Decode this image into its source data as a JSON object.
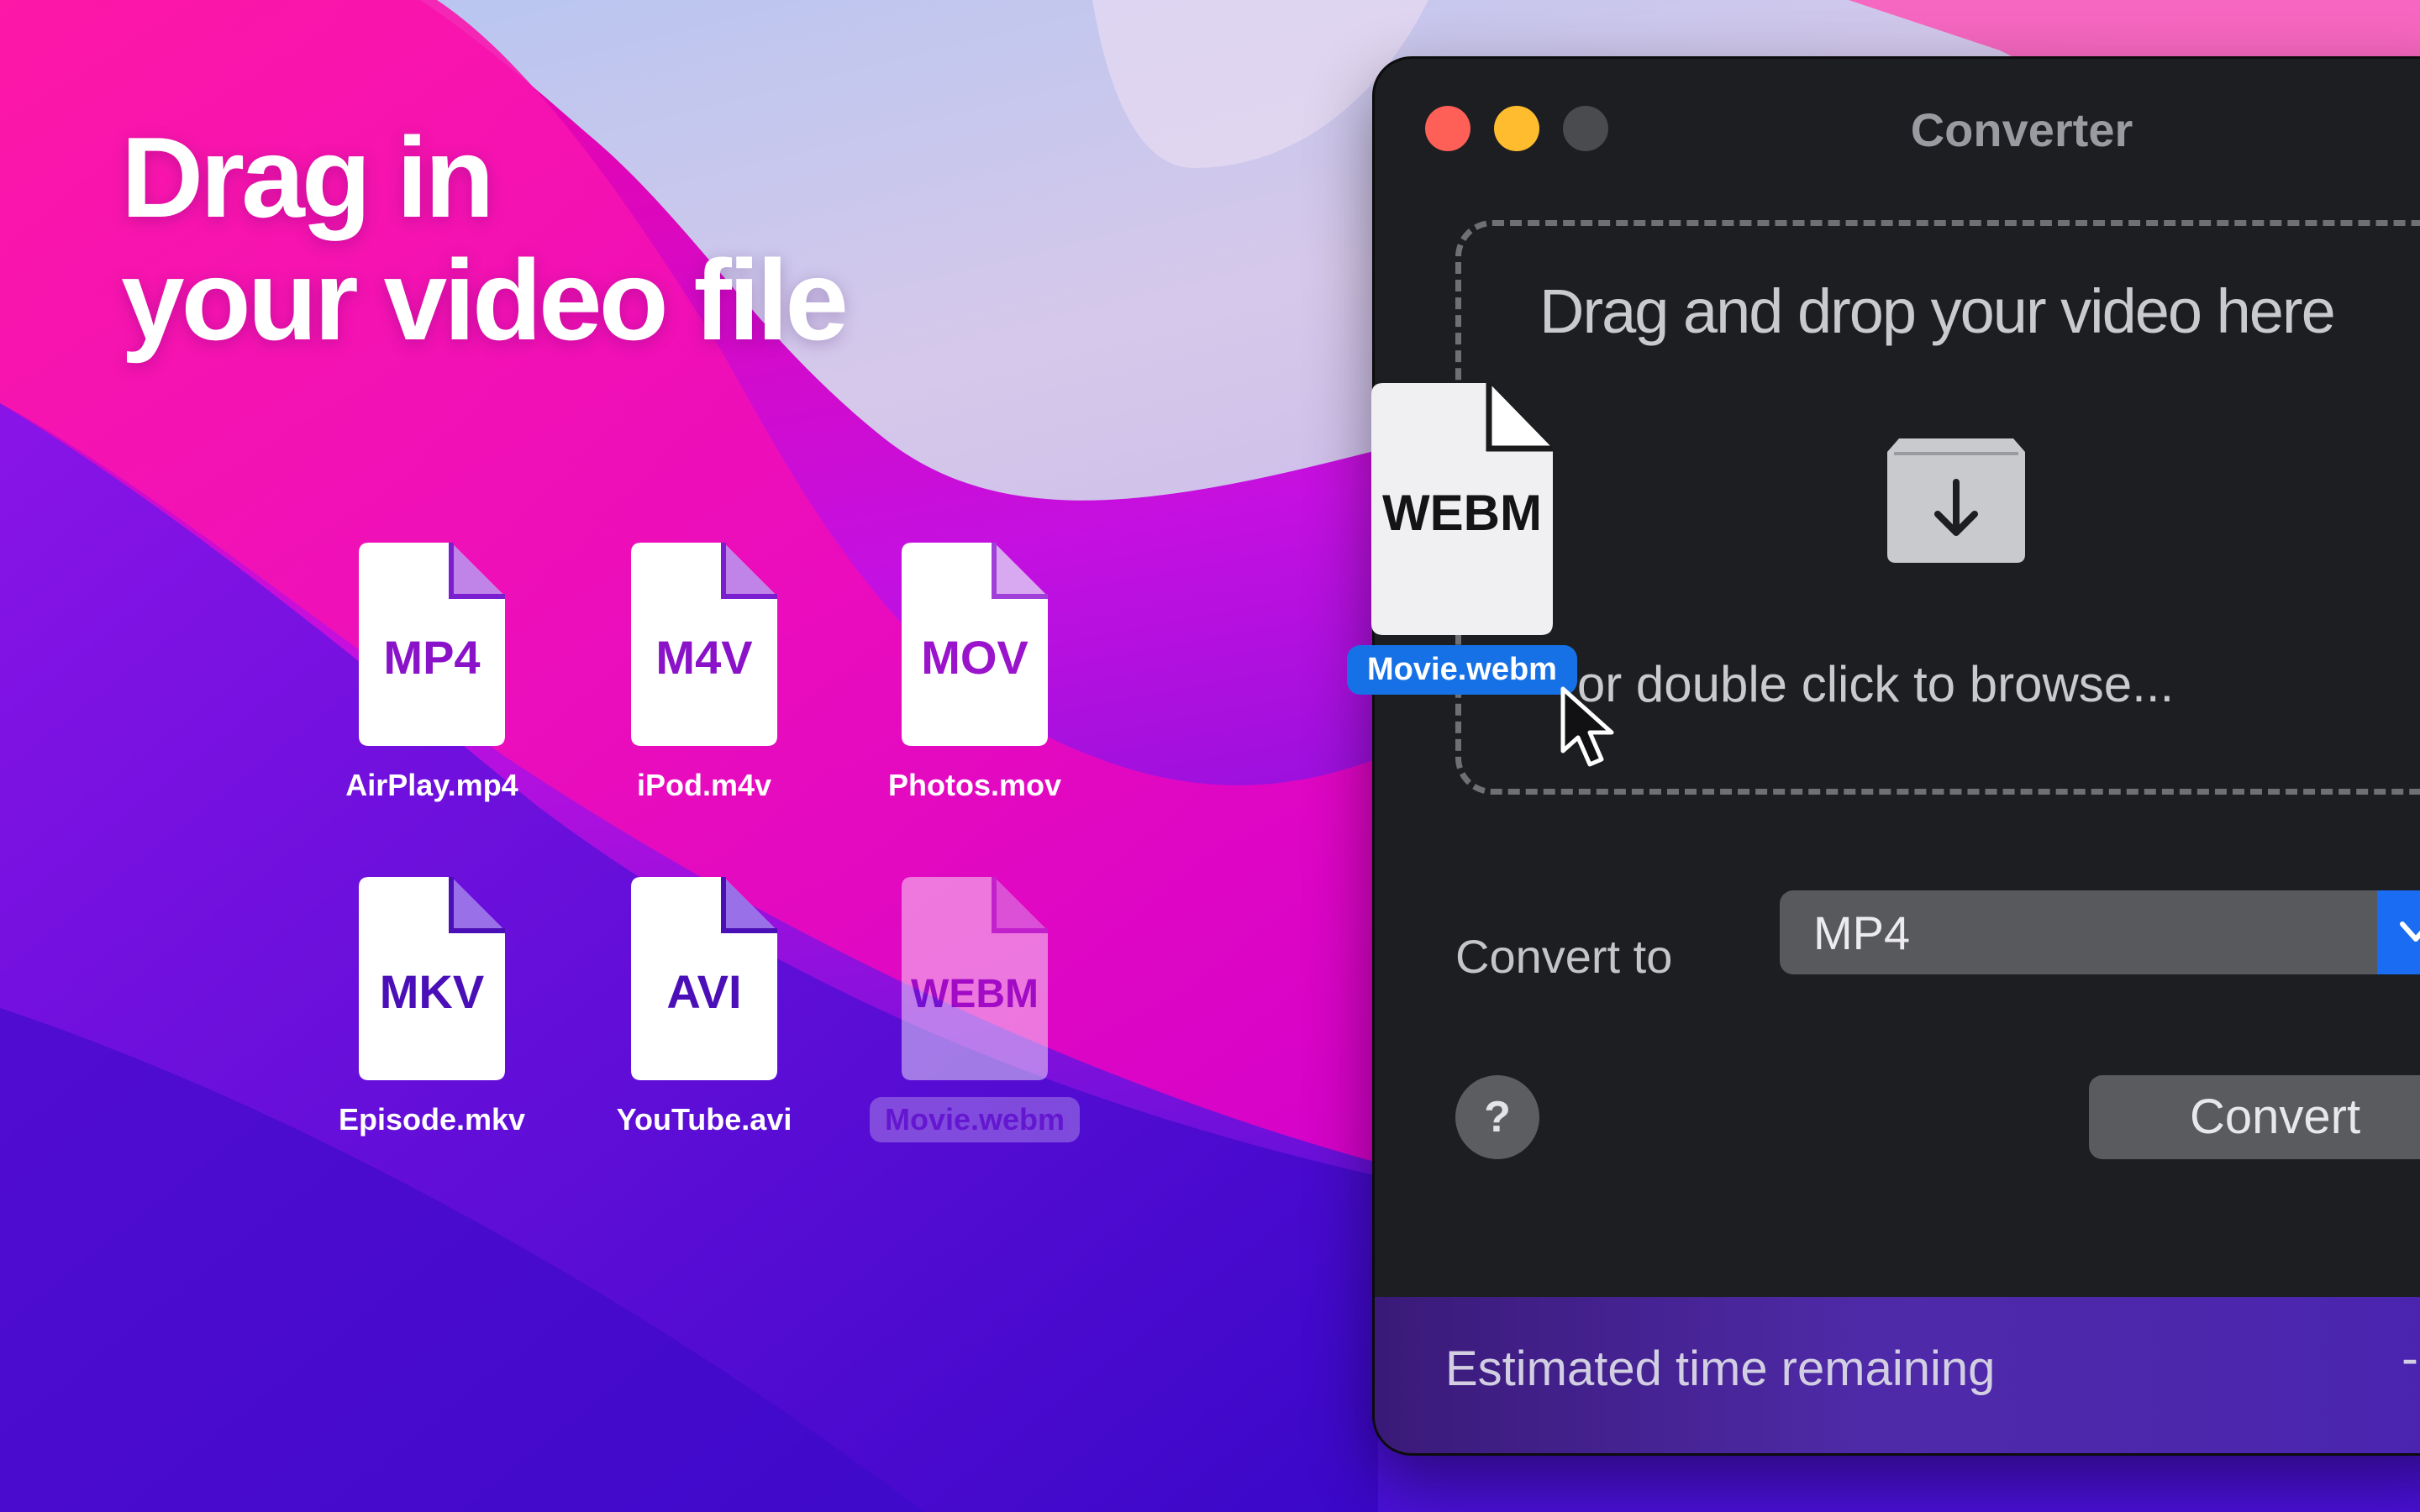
{
  "headline": {
    "line1": "Drag in",
    "line2": "your video file"
  },
  "desktop_files": [
    {
      "ext": "MP4",
      "name": "AirPlay.mp4"
    },
    {
      "ext": "M4V",
      "name": "iPod.m4v"
    },
    {
      "ext": "MOV",
      "name": "Photos.mov"
    },
    {
      "ext": "MKV",
      "name": "Episode.mkv"
    },
    {
      "ext": "AVI",
      "name": "YouTube.avi"
    },
    {
      "ext": "WEBM",
      "name": "Movie.webm"
    }
  ],
  "dragging_file": {
    "ext": "WEBM",
    "name": "Movie.webm"
  },
  "window": {
    "title": "Converter",
    "drop_zone": {
      "title": "Drag and drop your video here",
      "subtitle": "or double click to browse..."
    },
    "convert_to": {
      "label": "Convert to",
      "selected": "MP4"
    },
    "help_label": "?",
    "convert_label": "Convert",
    "status": {
      "label": "Estimated time remaining",
      "value": "-"
    }
  },
  "colors": {
    "file_text_purple": "#8a12c8",
    "file_text_indigo": "#4b0fb8",
    "accent_blue": "#1a6df3",
    "window_bg": "#1c1e21"
  },
  "icons": [
    "document-icon",
    "tray-download-icon",
    "chevron-down-icon",
    "cursor-arrow-icon"
  ]
}
